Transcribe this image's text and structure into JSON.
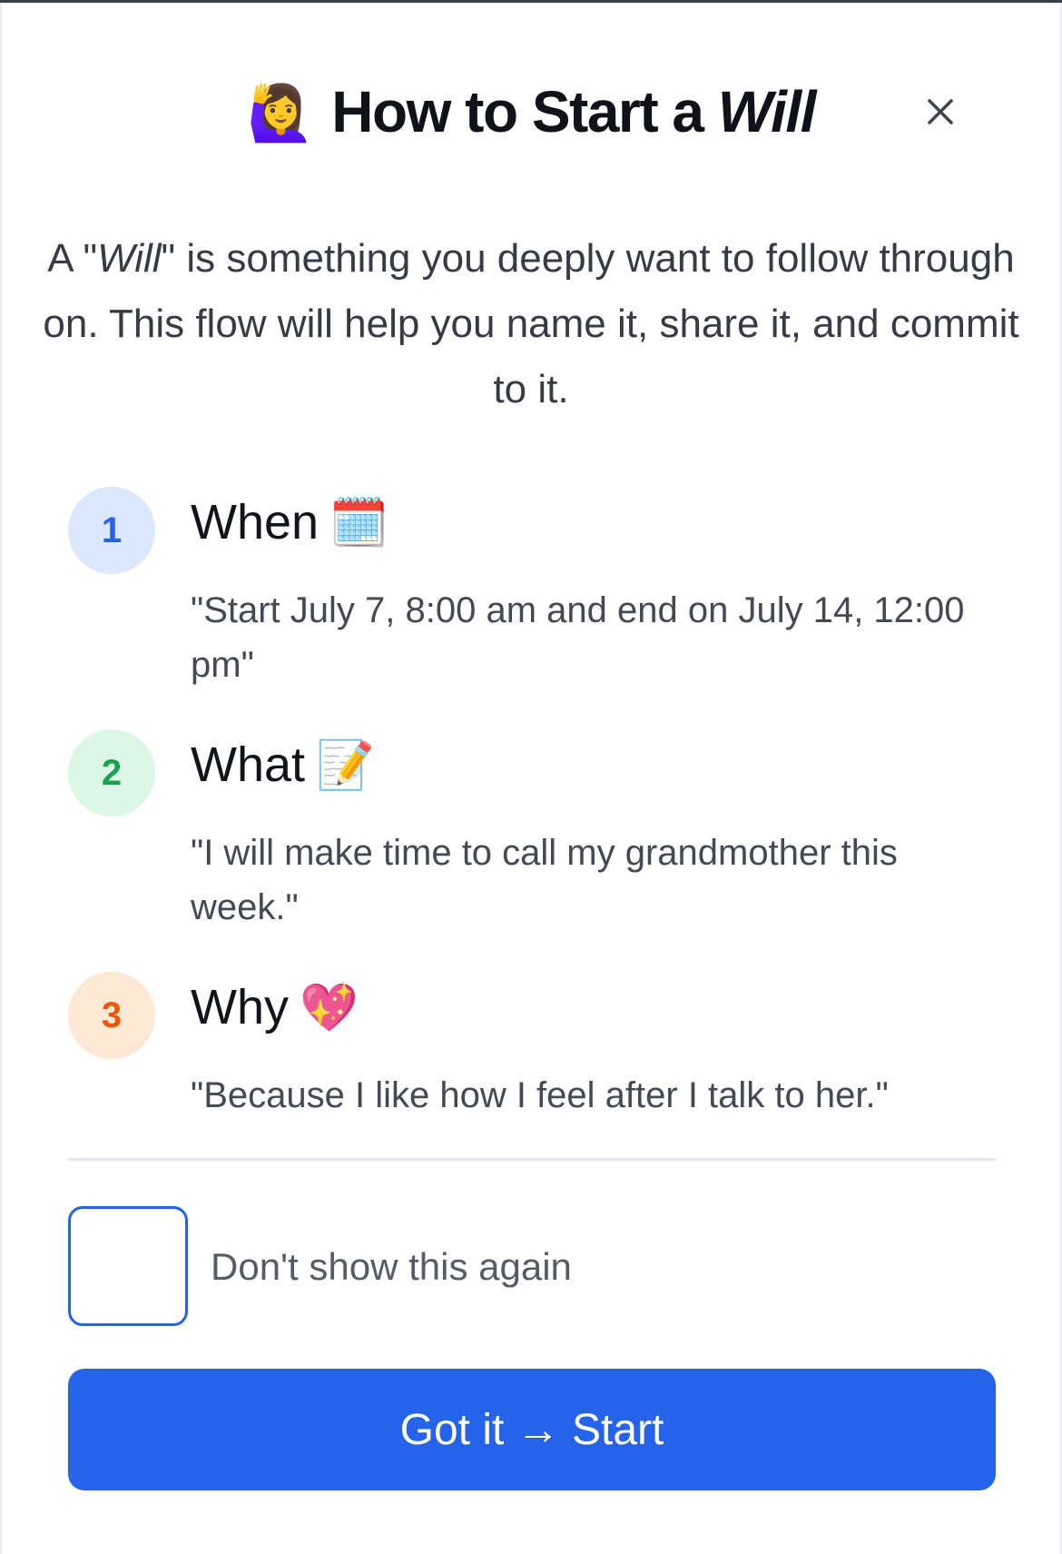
{
  "modal": {
    "title_emoji": "🙋‍♀️",
    "title_prefix": "How to Start a ",
    "title_emphasis": "Will",
    "close_icon": "close-icon"
  },
  "intro": {
    "part1": "A \"",
    "emphasis": "Will",
    "part2": "\" is something you deeply want to follow through on. This flow will help you name it, share it, and commit to it."
  },
  "steps": [
    {
      "number": "1",
      "title": "When",
      "emoji": "🗓️",
      "quote": "\"Start July 7, 8:00 am and end on July 14, 12:00 pm\"",
      "color": "#2563eb",
      "bg": "#dce8fd"
    },
    {
      "number": "2",
      "title": "What",
      "emoji": "📝",
      "quote": "\"I will make time to call my grandmother this week.\"",
      "color": "#16a34a",
      "bg": "#dcf7e6"
    },
    {
      "number": "3",
      "title": "Why",
      "emoji": "💖",
      "quote": "\"Because I like how I feel after I talk to her.\"",
      "color": "#ea580c",
      "bg": "#fde8d6"
    }
  ],
  "dont_show": {
    "label": "Don't show this again",
    "checked": false
  },
  "cta": {
    "label": "Got it → Start",
    "color": "#2563eb"
  }
}
